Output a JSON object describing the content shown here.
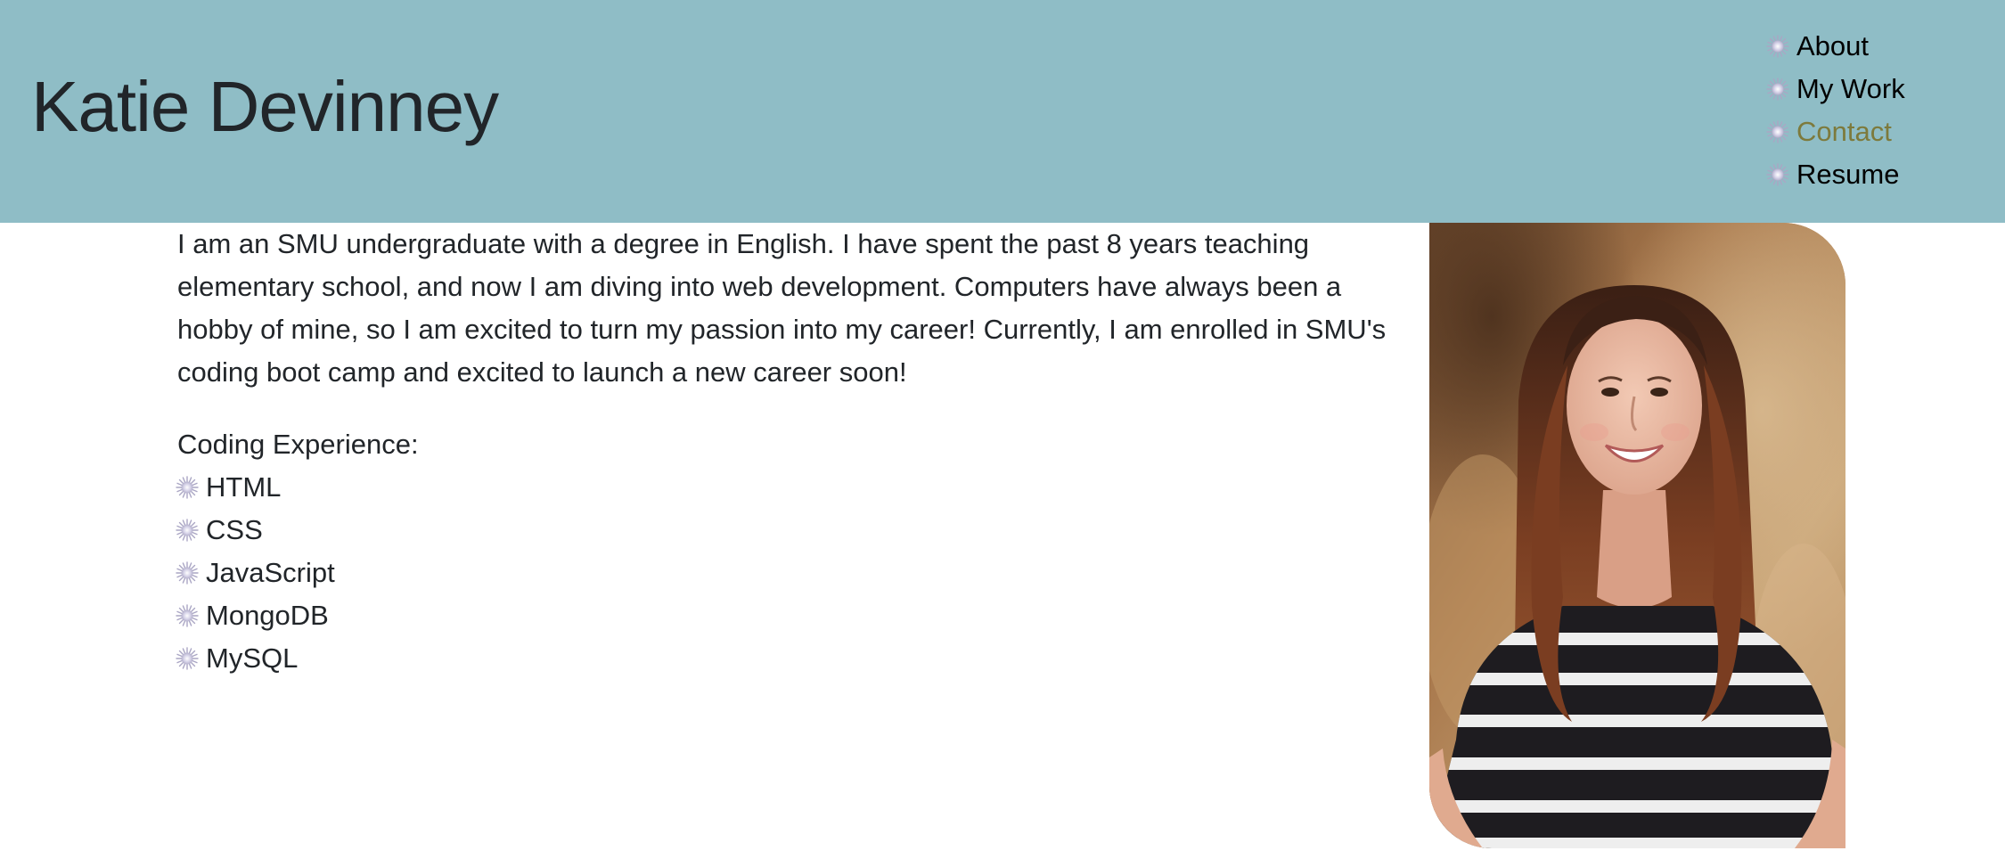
{
  "header": {
    "title": "Katie Devinney",
    "background_color": "#8fbdc6"
  },
  "nav": {
    "items": [
      {
        "label": "About",
        "icon": "burst-icon",
        "active": false
      },
      {
        "label": "My Work",
        "icon": "burst-icon",
        "active": false
      },
      {
        "label": "Contact",
        "icon": "burst-icon",
        "active": true
      },
      {
        "label": "Resume",
        "icon": "burst-icon",
        "active": false
      }
    ],
    "active_color": "#7d7a3c"
  },
  "main": {
    "bio": "I am an SMU undergraduate with a degree in English. I have spent the past 8 years teaching elementary school, and now I am diving into web development. Computers have always been a hobby of mine, so I am excited to turn my passion into my career! Currently, I am enrolled in SMU's coding boot camp and excited to launch a new career soon!",
    "experience_title": "Coding Experience:",
    "experience_items": [
      "HTML",
      "CSS",
      "JavaScript",
      "MongoDB",
      "MySQL"
    ]
  },
  "portrait": {
    "icon": "profile-photo"
  }
}
